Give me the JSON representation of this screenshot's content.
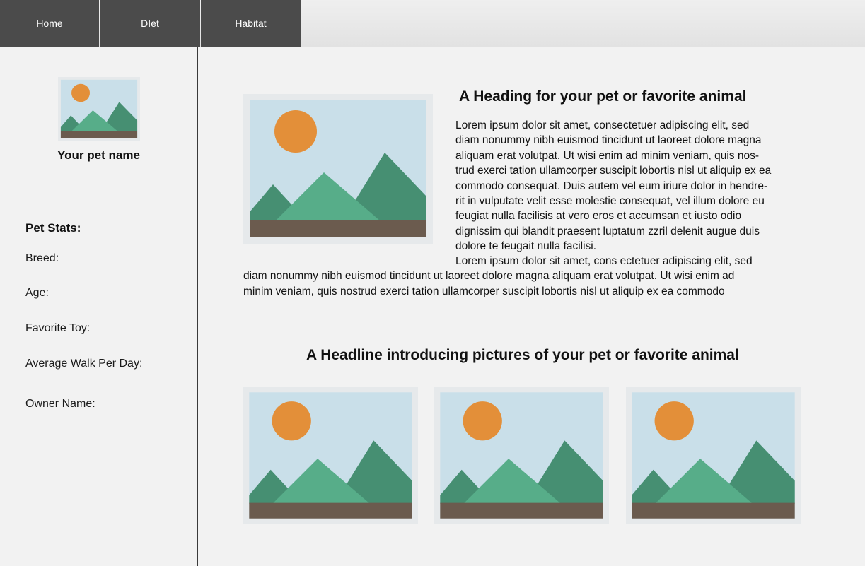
{
  "nav": {
    "tabs": [
      {
        "label": "Home"
      },
      {
        "label": "DIet"
      },
      {
        "label": "Habitat"
      }
    ]
  },
  "sidebar": {
    "pet_name": "Your pet name",
    "stats_title": "Pet Stats:",
    "stats": [
      {
        "label": "Breed:"
      },
      {
        "label": "Age:"
      },
      {
        "label": "Favorite Toy:"
      },
      {
        "label": "Average Walk Per Day:"
      },
      {
        "label": "Owner Name:"
      }
    ]
  },
  "main": {
    "heading": "A Heading for your pet or favorite animal",
    "paragraph1_lines": [
      "Lorem ipsum dolor sit amet, consectetuer adipiscing elit, sed",
      "diam nonummy nibh euismod tincidunt ut laoreet dolore magna",
      "aliquam erat volutpat. Ut wisi enim ad minim veniam, quis nos-",
      "trud exerci tation ullamcorper suscipit lobortis nisl ut aliquip ex ea",
      "commodo consequat. Duis autem vel eum iriure dolor in hendre-",
      "rit in vulputate velit esse molestie consequat, vel illum dolore eu",
      "feugiat nulla facilisis at vero eros et accumsan et iusto odio",
      "dignissim qui blandit praesent luptatum zzril delenit augue duis",
      "dolore te feugait nulla facilisi."
    ],
    "paragraph2_lines": [
      "Lorem ipsum dolor sit amet, cons ectetuer adipiscing elit, sed",
      "diam nonummy nibh euismod tincidunt ut laoreet dolore magna aliquam erat volutpat. Ut wisi enim ad",
      "minim veniam, quis nostrud exerci tation ullamcorper suscipit lobortis nisl ut aliquip ex ea commodo"
    ],
    "gallery_heading": "A Headline introducing pictures of your pet or favorite animal"
  },
  "colors": {
    "nav_tab": "#4b4b4b",
    "sky": "#c9dfe9",
    "sun": "#e38f39",
    "mountain_dark": "#468f72",
    "mountain_light": "#57ad89",
    "ground": "#6b5b4e",
    "frame": "#e6e9eb"
  },
  "icons": {
    "image_placeholder": "landscape-image-icon"
  }
}
